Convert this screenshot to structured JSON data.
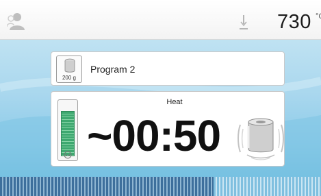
{
  "header": {
    "user_icon": "user-icon",
    "status_icon": "arrow-down-icon",
    "temperature": "730",
    "temperature_unit": "°C"
  },
  "program": {
    "icon": "cylinder-icon",
    "weight": "200 g",
    "name": "Program 2"
  },
  "heat_panel": {
    "level_icon": "battery-icon",
    "level_fraction": 0.86,
    "phase": "Heat",
    "remaining_time": "~00:50",
    "furnace_icon": "furnace-icon"
  },
  "progress": {
    "fraction": 0.665
  },
  "colors": {
    "accent_green": "#3ea870",
    "progress_dark": "#3d6f9c",
    "background_blue": "#a9d7ee"
  }
}
